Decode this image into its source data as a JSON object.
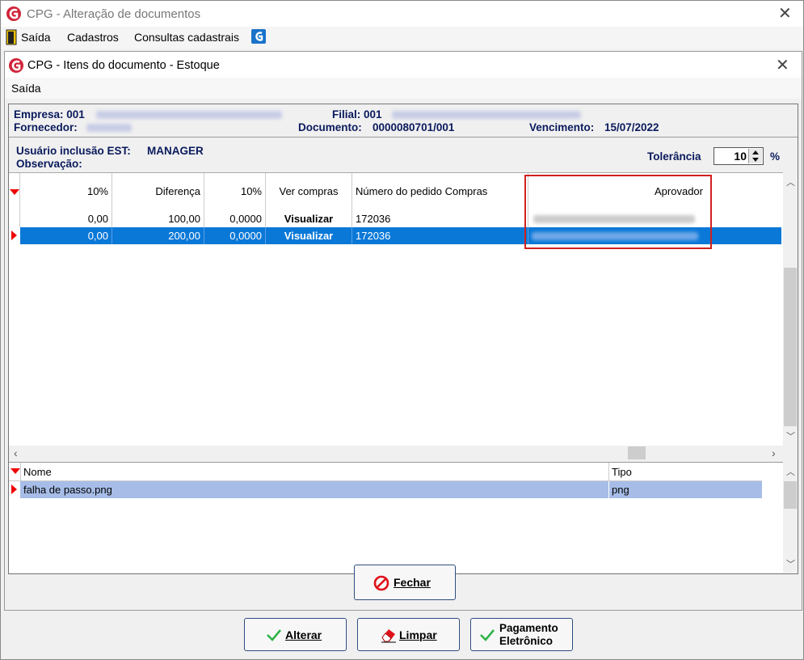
{
  "window": {
    "title": "CPG - Alteração de documentos"
  },
  "menu": {
    "items": [
      "Saída",
      "Cadastros",
      "Consultas cadastrais"
    ]
  },
  "dialog": {
    "title": "CPG - Itens do documento - Estoque",
    "menu_saida": "Saída"
  },
  "info": {
    "empresa_label": "Empresa: 001",
    "filial_label": "Filial: 001",
    "fornecedor_label": "Fornecedor:",
    "documento_label": "Documento:",
    "documento_value": "0000080701/001",
    "vencimento_label": "Vencimento:",
    "vencimento_value": "15/07/2022",
    "usuario_label": "Usuário inclusão EST:",
    "usuario_value": "MANAGER",
    "observacao_label": "Observação:",
    "tolerancia_label": "Tolerância",
    "tolerancia_value": "10",
    "percent": "%"
  },
  "grid": {
    "headers": [
      "10%",
      "Diferença",
      "10%",
      "Ver compras",
      "Número do pedido Compras",
      "Aprovador"
    ],
    "rows": [
      {
        "c1": "0,00",
        "c2": "100,00",
        "c3": "0,0000",
        "c4": "Visualizar",
        "c5": "172036"
      },
      {
        "c1": "0,00",
        "c2": "200,00",
        "c3": "0,0000",
        "c4": "Visualizar",
        "c5": "172036"
      }
    ]
  },
  "files": {
    "headers": [
      "Nome",
      "Tipo"
    ],
    "rows": [
      {
        "nome": "falha de passo.png",
        "tipo": "png"
      }
    ]
  },
  "buttons": {
    "fechar": "Fechar",
    "alterar": "Alterar",
    "limpar": "Limpar",
    "pagamento_line1": "Pagamento",
    "pagamento_line2": "Eletrônico"
  },
  "colors": {
    "selection": "#0a78d7",
    "file_selection": "#a7bde8",
    "label_blue": "#0a1a5c",
    "logo_red": "#d0253a",
    "highlight_box": "#d02020"
  }
}
